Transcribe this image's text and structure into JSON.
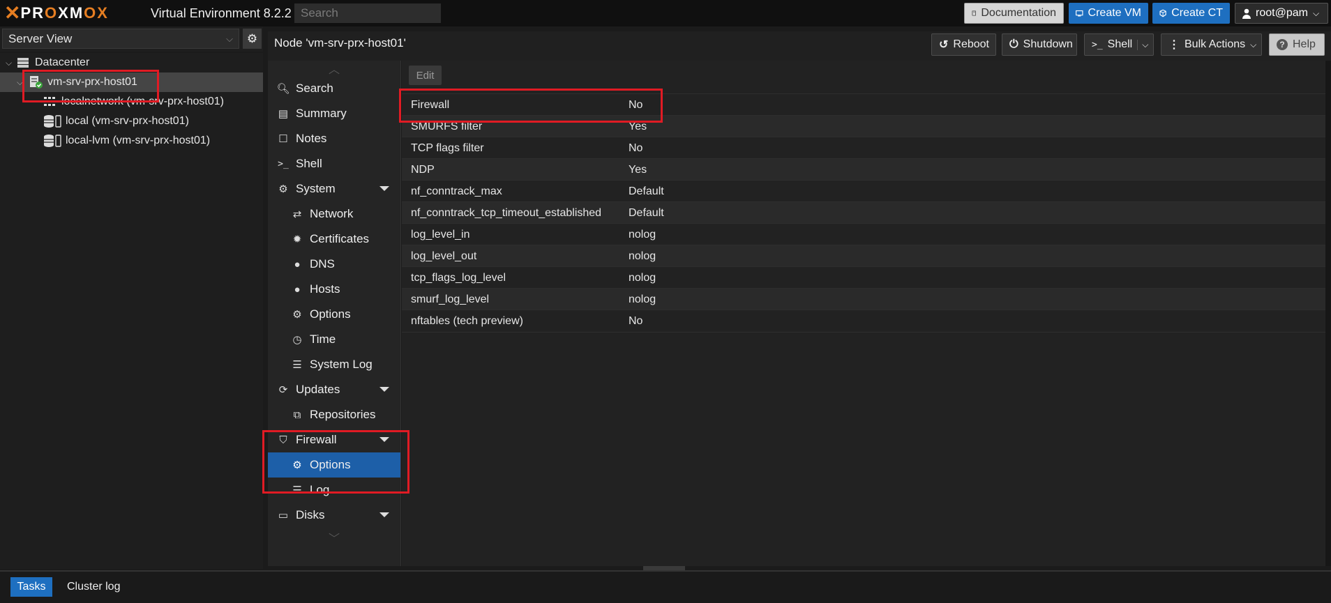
{
  "app": {
    "logo": "PROXMOX",
    "product": "Virtual Environment 8.2.2"
  },
  "topbar": {
    "search_placeholder": "Search",
    "documentation": "Documentation",
    "create_vm": "Create VM",
    "create_ct": "Create CT",
    "user": "root@pam"
  },
  "tree": {
    "view": "Server View",
    "items": [
      {
        "label": "Datacenter",
        "icon": "datacenter-icon"
      },
      {
        "label": "vm-srv-prx-host01",
        "icon": "node-online-icon"
      },
      {
        "label": "localnetwork (vm-srv-prx-host01)",
        "icon": "network-grid-icon"
      },
      {
        "label": "local (vm-srv-prx-host01)",
        "icon": "storage-icon"
      },
      {
        "label": "local-lvm (vm-srv-prx-host01)",
        "icon": "storage-icon"
      }
    ]
  },
  "node": {
    "title": "Node 'vm-srv-prx-host01'",
    "reboot": "Reboot",
    "shutdown": "Shutdown",
    "shell": "Shell",
    "bulk_actions": "Bulk Actions",
    "help": "Help"
  },
  "nav": [
    {
      "label": "Search",
      "icon": "search-icon"
    },
    {
      "label": "Summary",
      "icon": "summary-icon"
    },
    {
      "label": "Notes",
      "icon": "notes-icon"
    },
    {
      "label": "Shell",
      "icon": "terminal-icon"
    },
    {
      "label": "System",
      "icon": "cogs-icon"
    },
    {
      "label": "Network",
      "icon": "exchange-icon"
    },
    {
      "label": "Certificates",
      "icon": "certificate-icon"
    },
    {
      "label": "DNS",
      "icon": "globe-icon"
    },
    {
      "label": "Hosts",
      "icon": "globe-icon"
    },
    {
      "label": "Options",
      "icon": "gear-icon"
    },
    {
      "label": "Time",
      "icon": "clock-icon"
    },
    {
      "label": "System Log",
      "icon": "list-icon"
    },
    {
      "label": "Updates",
      "icon": "refresh-icon"
    },
    {
      "label": "Repositories",
      "icon": "files-icon"
    },
    {
      "label": "Firewall",
      "icon": "shield-icon"
    },
    {
      "label": "Options",
      "icon": "gear-icon"
    },
    {
      "label": "Log",
      "icon": "list-icon"
    },
    {
      "label": "Disks",
      "icon": "hdd-icon"
    }
  ],
  "content": {
    "edit": "Edit",
    "rows": [
      {
        "key": "Firewall",
        "value": "No"
      },
      {
        "key": "SMURFS filter",
        "value": "Yes"
      },
      {
        "key": "TCP flags filter",
        "value": "No"
      },
      {
        "key": "NDP",
        "value": "Yes"
      },
      {
        "key": "nf_conntrack_max",
        "value": "Default"
      },
      {
        "key": "nf_conntrack_tcp_timeout_established",
        "value": "Default"
      },
      {
        "key": "log_level_in",
        "value": "nolog"
      },
      {
        "key": "log_level_out",
        "value": "nolog"
      },
      {
        "key": "tcp_flags_log_level",
        "value": "nolog"
      },
      {
        "key": "smurf_log_level",
        "value": "nolog"
      },
      {
        "key": "nftables (tech preview)",
        "value": "No"
      }
    ]
  },
  "bottom": {
    "tasks": "Tasks",
    "cluster_log": "Cluster log"
  },
  "colors": {
    "accent": "#1e6fc0",
    "highlight": "#e01b24",
    "brand": "#e67e22"
  }
}
